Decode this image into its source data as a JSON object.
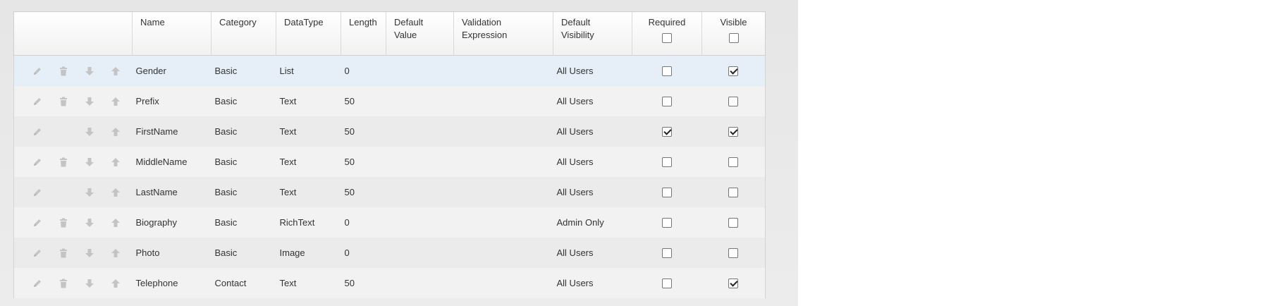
{
  "columns": {
    "name": "Name",
    "category": "Category",
    "datatype": "DataType",
    "length": "Length",
    "default_value_1": "Default",
    "default_value_2": "Value",
    "validation_1": "Validation",
    "validation_2": "Expression",
    "default_visibility_1": "Default",
    "default_visibility_2": "Visibility",
    "required": "Required",
    "visible": "Visible"
  },
  "header_checks": {
    "required": false,
    "visible": false
  },
  "rows": [
    {
      "name": "Gender",
      "category": "Basic",
      "datatype": "List",
      "length": "0",
      "default_value": "",
      "validation": "",
      "visibility": "All Users",
      "required": false,
      "visible": true,
      "deletable": true,
      "selected": true
    },
    {
      "name": "Prefix",
      "category": "Basic",
      "datatype": "Text",
      "length": "50",
      "default_value": "",
      "validation": "",
      "visibility": "All Users",
      "required": false,
      "visible": false,
      "deletable": true,
      "selected": false
    },
    {
      "name": "FirstName",
      "category": "Basic",
      "datatype": "Text",
      "length": "50",
      "default_value": "",
      "validation": "",
      "visibility": "All Users",
      "required": true,
      "visible": true,
      "deletable": false,
      "selected": false
    },
    {
      "name": "MiddleName",
      "category": "Basic",
      "datatype": "Text",
      "length": "50",
      "default_value": "",
      "validation": "",
      "visibility": "All Users",
      "required": false,
      "visible": false,
      "deletable": true,
      "selected": false
    },
    {
      "name": "LastName",
      "category": "Basic",
      "datatype": "Text",
      "length": "50",
      "default_value": "",
      "validation": "",
      "visibility": "All Users",
      "required": false,
      "visible": false,
      "deletable": false,
      "selected": false
    },
    {
      "name": "Biography",
      "category": "Basic",
      "datatype": "RichText",
      "length": "0",
      "default_value": "",
      "validation": "",
      "visibility": "Admin Only",
      "required": false,
      "visible": false,
      "deletable": true,
      "selected": false
    },
    {
      "name": "Photo",
      "category": "Basic",
      "datatype": "Image",
      "length": "0",
      "default_value": "",
      "validation": "",
      "visibility": "All Users",
      "required": false,
      "visible": false,
      "deletable": true,
      "selected": false
    },
    {
      "name": "Telephone",
      "category": "Contact",
      "datatype": "Text",
      "length": "50",
      "default_value": "",
      "validation": "",
      "visibility": "All Users",
      "required": false,
      "visible": true,
      "deletable": true,
      "selected": false
    }
  ],
  "icons": {
    "edit": "pencil-icon",
    "delete": "trash-icon",
    "move_down": "arrow-down-icon",
    "move_up": "arrow-up-icon"
  },
  "colors": {
    "selected_row": "#e6eff8",
    "row_even": "#f2f2f2",
    "row_odd": "#ebebeb",
    "icon": "#c4c4c4"
  }
}
